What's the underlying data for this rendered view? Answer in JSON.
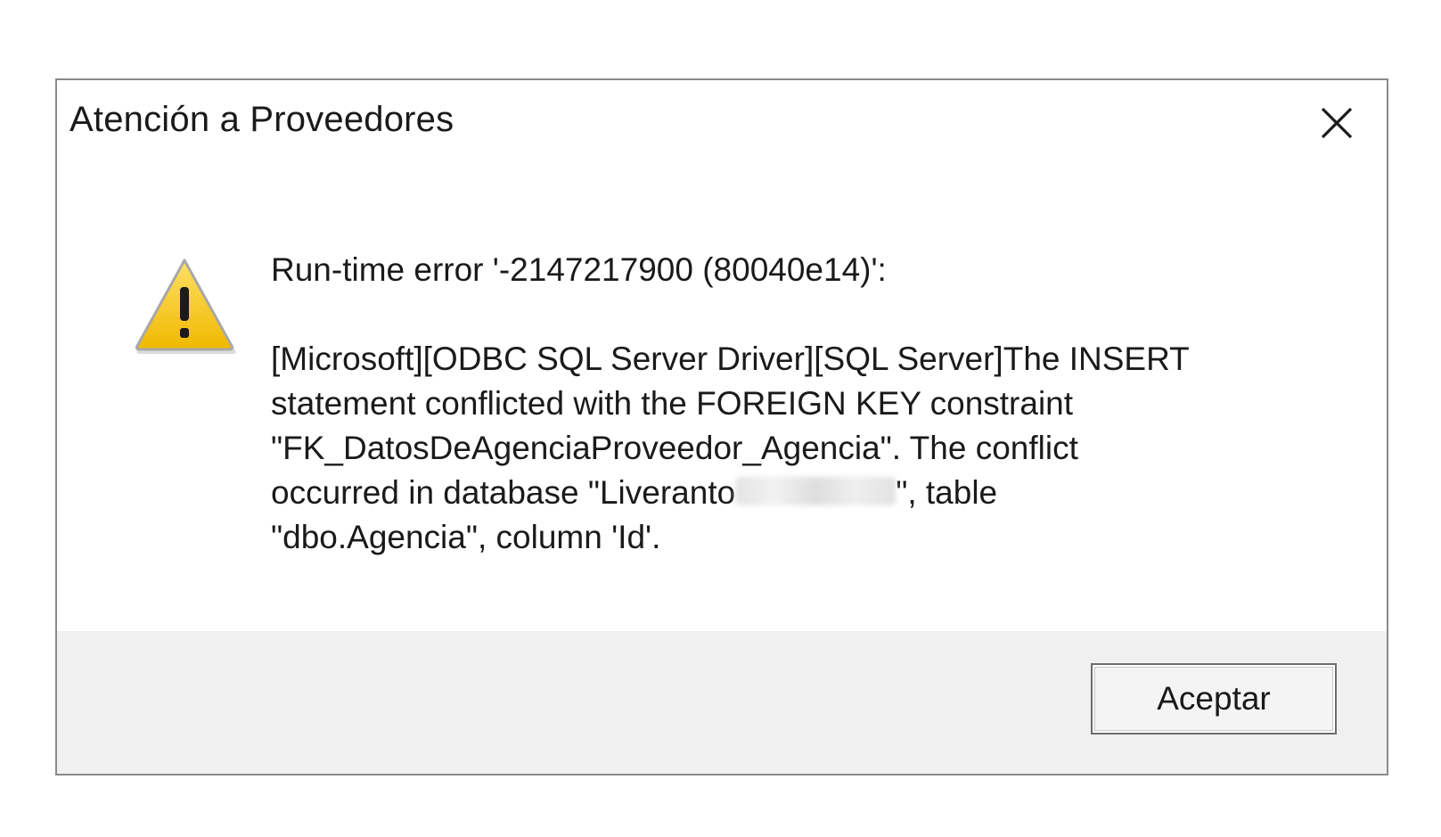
{
  "window": {
    "title": "Atención a Proveedores",
    "close_icon": "close-icon"
  },
  "dialog": {
    "icon": "warning-icon",
    "heading": "Run-time error '-2147217900 (80040e14)':",
    "message_line1": "[Microsoft][ODBC SQL Server Driver][SQL Server]The INSERT",
    "message_line2": "statement conflicted with the FOREIGN KEY constraint",
    "message_line3": "\"FK_DatosDeAgenciaProveedor_Agencia\". The conflict",
    "message_line4_prefix": "occurred in database \"Liveranto",
    "message_line4_suffix": "\", table",
    "message_line5": "\"dbo.Agencia\", column 'Id'."
  },
  "footer": {
    "ok_label": "Aceptar"
  },
  "colors": {
    "footer_bg": "#f0f0f0",
    "warning_yellow": "#f5c400",
    "border": "#8a8a8a"
  }
}
